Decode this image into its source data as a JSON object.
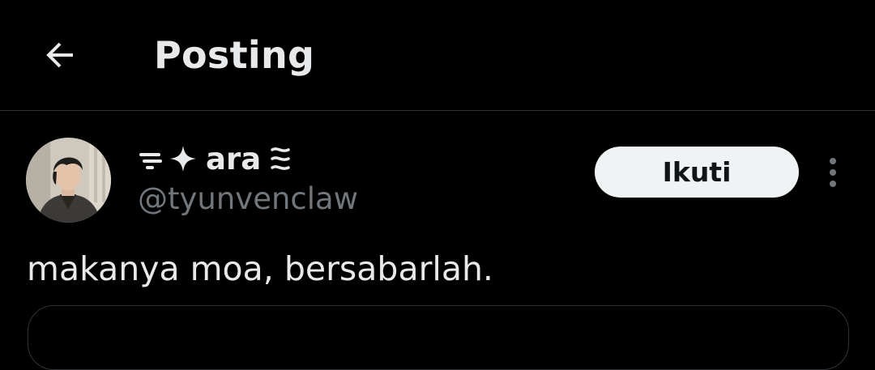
{
  "header": {
    "title": "Posting",
    "back_icon": "arrow-left-icon"
  },
  "post": {
    "author": {
      "name_prefix_icon": "sparkle-dash-emoji-icon",
      "display_name": "ara",
      "name_suffix_icon": "wavy-lines-emoji-icon",
      "handle": "@tyunvenclaw"
    },
    "follow_label": "Ikuti",
    "more_icon": "more-vertical-icon",
    "text": "makanya moa, bersabarlah."
  },
  "colors": {
    "background": "#000000",
    "text_primary": "#e7e9ea",
    "text_secondary": "#71767b",
    "divider": "#2f3336",
    "button_bg": "#eff3f4",
    "button_text": "#0f1419"
  }
}
